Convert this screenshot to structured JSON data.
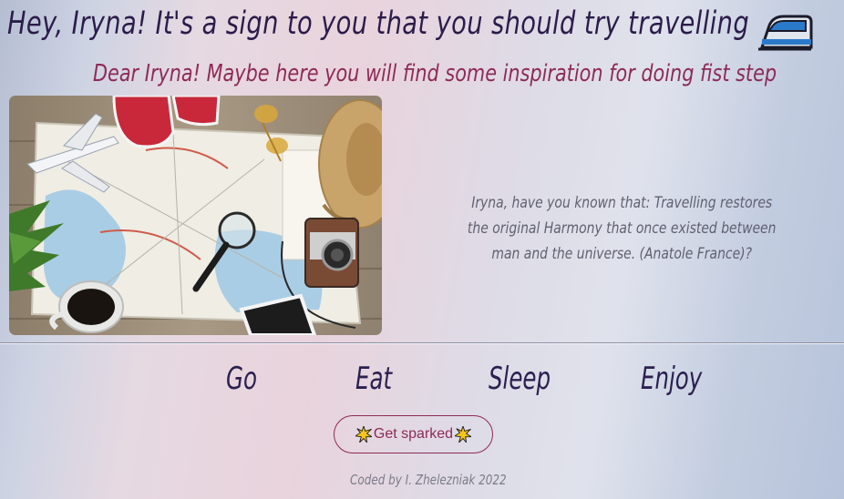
{
  "header": {
    "title": "Hey, Iryna! It's a sign to you that you should try travelling",
    "title_icon": "high-speed-train-icon",
    "subtitle": "Dear Iryna! Maybe here you will find some inspiration for doing fist step"
  },
  "hero": {
    "image": "travel-flatlay-photo",
    "image_icons": [
      "airplane-icon",
      "sneakers-icon",
      "map-icon",
      "magnifier-icon",
      "sunglasses-icon",
      "straw-hat-icon",
      "camera-icon",
      "coffee-cup-icon",
      "plant-icon",
      "phone-icon"
    ],
    "quote": "Iryna, have you known that: Travelling restores the original Harmony that once existed between man and the universe. (Anatole France)?"
  },
  "nav": {
    "items": [
      {
        "label": "Go"
      },
      {
        "label": "Eat"
      },
      {
        "label": "Sleep"
      },
      {
        "label": "Enjoy"
      }
    ]
  },
  "cta": {
    "label": "Get sparked",
    "icon": "sparkle-icon"
  },
  "footer": {
    "text": "Coded by I. Zhelezniak 2022"
  },
  "colors": {
    "title": "#2b1c4a",
    "subtitle": "#8e2a57",
    "quote": "#606070",
    "button_border": "#8e2a57"
  }
}
